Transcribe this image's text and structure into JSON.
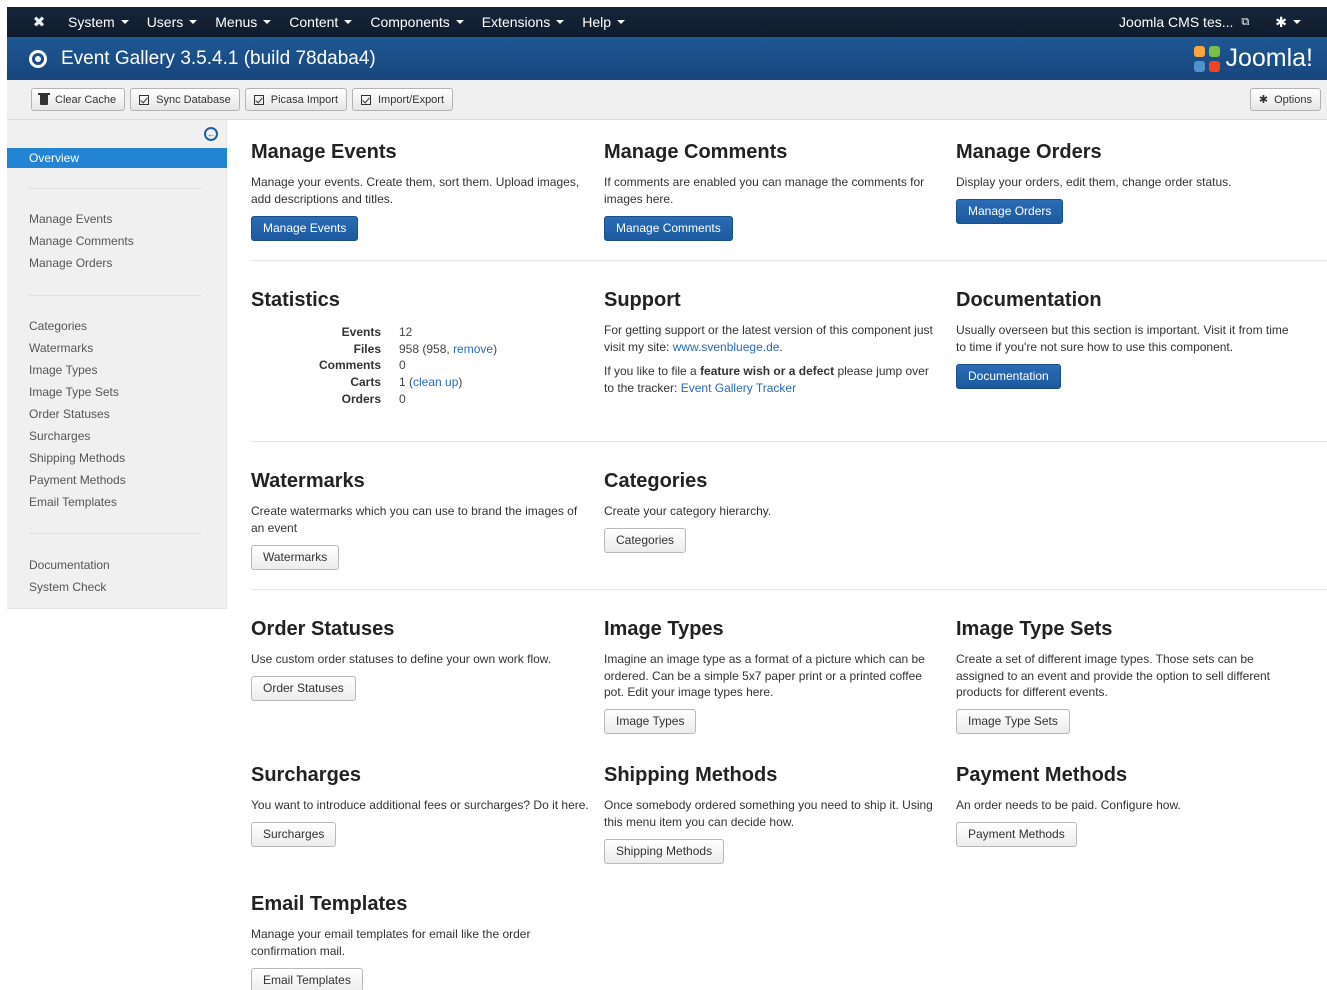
{
  "nav": {
    "items": [
      "System",
      "Users",
      "Menus",
      "Content",
      "Components",
      "Extensions",
      "Help"
    ],
    "site_name": "Joomla CMS tes..."
  },
  "title": {
    "text": "Event Gallery 3.5.4.1 (build 78daba4)",
    "logo_text": "Joomla!"
  },
  "toolbar": {
    "clear_cache": "Clear Cache",
    "sync_database": "Sync Database",
    "picasa_import": "Picasa Import",
    "import_export": "Import/Export",
    "options": "Options"
  },
  "sidebar": {
    "active": "Overview",
    "group1": [
      "Manage Events",
      "Manage Comments",
      "Manage Orders"
    ],
    "group2": [
      "Categories",
      "Watermarks",
      "Image Types",
      "Image Type Sets",
      "Order Statuses",
      "Surcharges",
      "Shipping Methods",
      "Payment Methods",
      "Email Templates"
    ],
    "group3": [
      "Documentation",
      "System Check"
    ]
  },
  "sections": {
    "manage_events": {
      "title": "Manage Events",
      "desc": "Manage your events. Create them, sort them. Upload images, add descriptions and titles.",
      "button": "Manage Events"
    },
    "manage_comments": {
      "title": "Manage Comments",
      "desc": "If comments are enabled you can manage the comments for images here.",
      "button": "Manage Comments"
    },
    "manage_orders": {
      "title": "Manage Orders",
      "desc": "Display your orders, edit them, change order status.",
      "button": "Manage Orders"
    },
    "statistics": {
      "title": "Statistics",
      "events_label": "Events",
      "events_value": "12",
      "files_label": "Files",
      "files_value": "958 (958,",
      "files_link": "remove",
      "files_suffix": ")",
      "comments_label": "Comments",
      "comments_value": "0",
      "carts_label": "Carts",
      "carts_value": "1 (",
      "carts_link": "clean up",
      "carts_suffix": ")",
      "orders_label": "Orders",
      "orders_value": "0"
    },
    "support": {
      "title": "Support",
      "p1": "For getting support or the latest version of this component just visit my site:",
      "p1_link": "www.svenbluege.de",
      "p2_a": "If you like to file a",
      "p2_bold": "feature wish or a defect",
      "p2_b": "please jump over to the tracker:",
      "p2_link": "Event Gallery Tracker"
    },
    "documentation": {
      "title": "Documentation",
      "desc": "Usually overseen but this section is important. Visit it from time to time if you're not sure how to use this component.",
      "button": "Documentation"
    },
    "watermarks": {
      "title": "Watermarks",
      "desc": "Create watermarks which you can use to brand the images of an event",
      "button": "Watermarks"
    },
    "categories": {
      "title": "Categories",
      "desc": "Create your category hierarchy.",
      "button": "Categories"
    },
    "order_statuses": {
      "title": "Order Statuses",
      "desc": "Use custom order statuses to define your own work flow.",
      "button": "Order Statuses"
    },
    "image_types": {
      "title": "Image Types",
      "desc": "Imagine an image type as a format of a picture which can be ordered. Can be a simple 5x7 paper print or a printed coffee pot. Edit your image types here.",
      "button": "Image Types"
    },
    "image_type_sets": {
      "title": "Image Type Sets",
      "desc": "Create a set of different image types. Those sets can be assigned to an event and provide the option to sell different products for different events.",
      "button": "Image Type Sets"
    },
    "surcharges": {
      "title": "Surcharges",
      "desc": "You want to introduce additional fees or surcharges? Do it here.",
      "button": "Surcharges"
    },
    "shipping_methods": {
      "title": "Shipping Methods",
      "desc": "Once somebody ordered something you need to ship it. Using this menu item you can decide how.",
      "button": "Shipping Methods"
    },
    "payment_methods": {
      "title": "Payment Methods",
      "desc": "An order needs to be paid. Configure how.",
      "button": "Payment Methods"
    },
    "email_templates": {
      "title": "Email Templates",
      "desc": "Manage your email templates for email like the order confirmation mail.",
      "button": "Email Templates"
    }
  }
}
